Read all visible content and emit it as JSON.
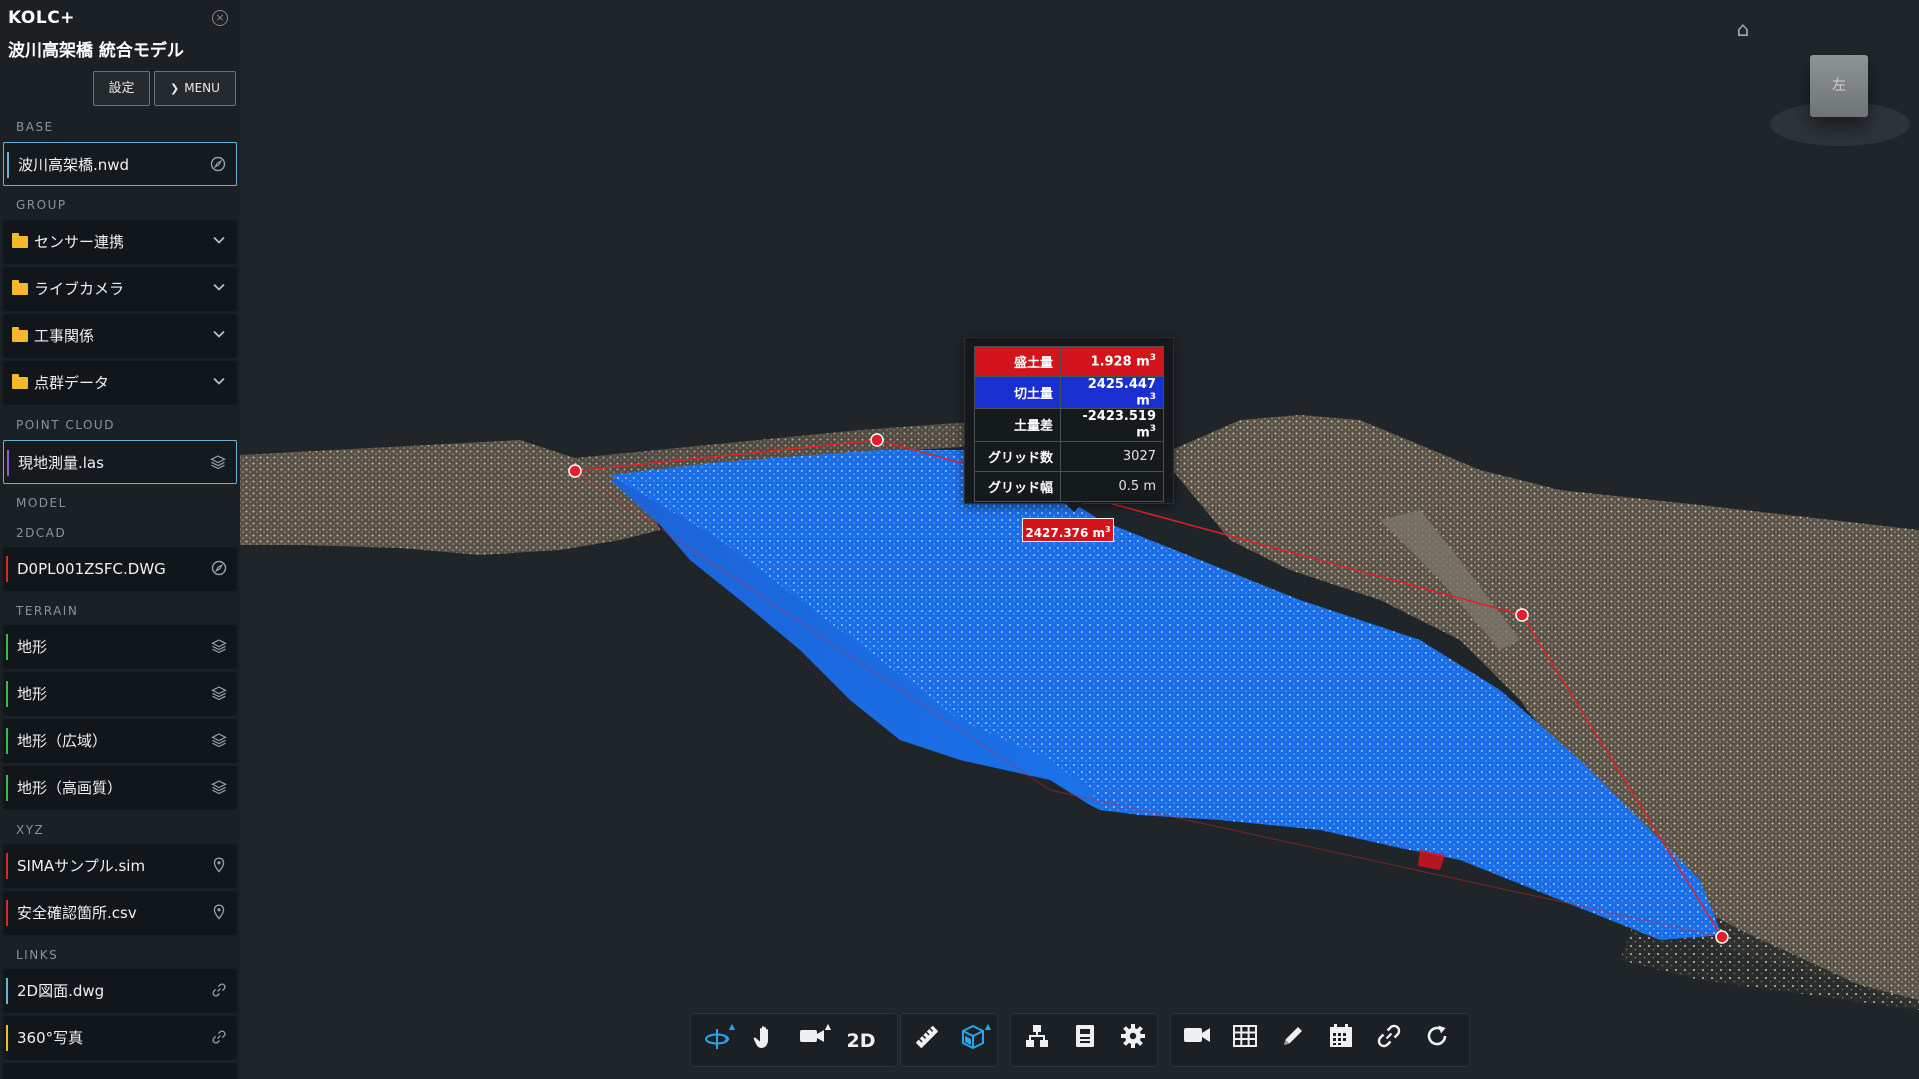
{
  "app": {
    "brand": "KOLC+",
    "project_title": "波川高架橋 統合モデル"
  },
  "header": {
    "settings_label": "設定",
    "menu_label": "MENU"
  },
  "sidebar": {
    "base": {
      "label": "BASE",
      "items": [
        {
          "name": "波川高架橋.nwd",
          "icon": "compass-icon",
          "color": "#6cb2d8"
        }
      ]
    },
    "group": {
      "label": "GROUP",
      "items": [
        {
          "name": "センサー連携",
          "icon": "chevron-down-icon"
        },
        {
          "name": "ライブカメラ",
          "icon": "chevron-down-icon"
        },
        {
          "name": "工事関係",
          "icon": "chevron-down-icon"
        },
        {
          "name": "点群データ",
          "icon": "chevron-down-icon"
        }
      ]
    },
    "point_cloud": {
      "label": "POINT CLOUD",
      "items": [
        {
          "name": "現地測量.las",
          "icon": "layers-icon",
          "color": "#9b59d0"
        }
      ]
    },
    "model": {
      "label": "MODEL"
    },
    "cad2d": {
      "label": "2DCAD",
      "items": [
        {
          "name": "D0PL001ZSFC.DWG",
          "icon": "compass-icon",
          "color": "#d8262c"
        }
      ]
    },
    "terrain": {
      "label": "TERRAIN",
      "items": [
        {
          "name": "地形",
          "icon": "layers-icon",
          "color": "#2fbf4a"
        },
        {
          "name": "地形",
          "icon": "layers-icon",
          "color": "#2fbf4a"
        },
        {
          "name": "地形（広域）",
          "icon": "layers-icon",
          "color": "#2fbf4a"
        },
        {
          "name": "地形（高画質）",
          "icon": "layers-icon",
          "color": "#2fbf4a"
        }
      ]
    },
    "xyz": {
      "label": "XYZ",
      "items": [
        {
          "name": "SIMAサンプル.sim",
          "icon": "pin-icon",
          "color": "#d8262c"
        },
        {
          "name": "安全確認箇所.csv",
          "icon": "pin-icon",
          "color": "#d8262c"
        }
      ]
    },
    "links": {
      "label": "LINKS",
      "items": [
        {
          "name": "2D図面.dwg",
          "icon": "link-icon",
          "color": "#6cb2d8"
        },
        {
          "name": "360°写真",
          "icon": "link-icon",
          "color": "#f3b82c"
        }
      ]
    }
  },
  "viewer": {
    "view_cube_label": "左"
  },
  "volume_popup": {
    "rows": [
      {
        "key": "盛土量",
        "value": "1.928 m",
        "exp": "3"
      },
      {
        "key": "切土量",
        "value": "2425.447 m",
        "exp": "3"
      },
      {
        "key": "土量差",
        "value": "-2423.519 m",
        "exp": "3"
      },
      {
        "key": "グリッド数",
        "value": "3027"
      },
      {
        "key": "グリッド幅",
        "value": "0.5 m"
      }
    ],
    "total": {
      "value": "2427.376 m",
      "exp": "3"
    }
  },
  "toolbar": {
    "mode_2d_label": "2D",
    "groups": [
      [
        "orbit-icon",
        "pan-hand-icon",
        "camera-icon",
        "2d-toggle"
      ],
      [
        "ruler-icon",
        "volume-box-icon"
      ],
      [
        "hierarchy-icon",
        "properties-icon",
        "settings-gear-icon"
      ],
      [
        "video-camera-icon",
        "grid-table-icon",
        "pencil-icon",
        "calendar-icon",
        "link-icon",
        "refresh-icon"
      ]
    ],
    "active": [
      "orbit-icon",
      "volume-box-icon"
    ]
  },
  "colors": {
    "fill": "#d4141d",
    "cut": "#1a2fd0",
    "accent": "#2aa4ea",
    "cut_surface": "#1a6ee8"
  }
}
